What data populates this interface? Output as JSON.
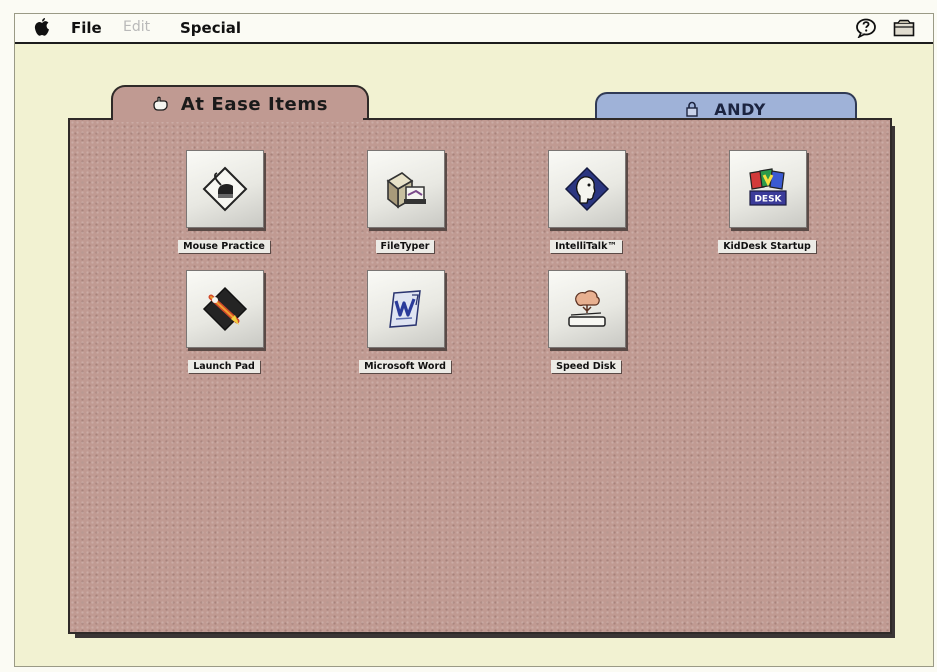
{
  "menubar": {
    "file": "File",
    "edit": "Edit",
    "special": "Special"
  },
  "tabs": {
    "items_label": "At Ease Items",
    "user_label": "ANDY"
  },
  "items": [
    {
      "label": "Mouse Practice",
      "icon": "mouse-practice-icon"
    },
    {
      "label": "FileTyper",
      "icon": "filetyper-icon"
    },
    {
      "label": "IntelliTalk™",
      "icon": "intellitalk-icon"
    },
    {
      "label": "KidDesk Startup",
      "icon": "kiddesk-icon"
    },
    {
      "label": "Launch Pad",
      "icon": "launch-pad-icon"
    },
    {
      "label": "Microsoft Word",
      "icon": "microsoft-word-icon"
    },
    {
      "label": "Speed Disk",
      "icon": "speed-disk-icon"
    }
  ],
  "icon_texts": {
    "kiddesk_badge": "DESK"
  },
  "colors": {
    "desktop": "#f2f2d2",
    "folder": "#c09a92",
    "user_tab": "#9fb2d8"
  }
}
